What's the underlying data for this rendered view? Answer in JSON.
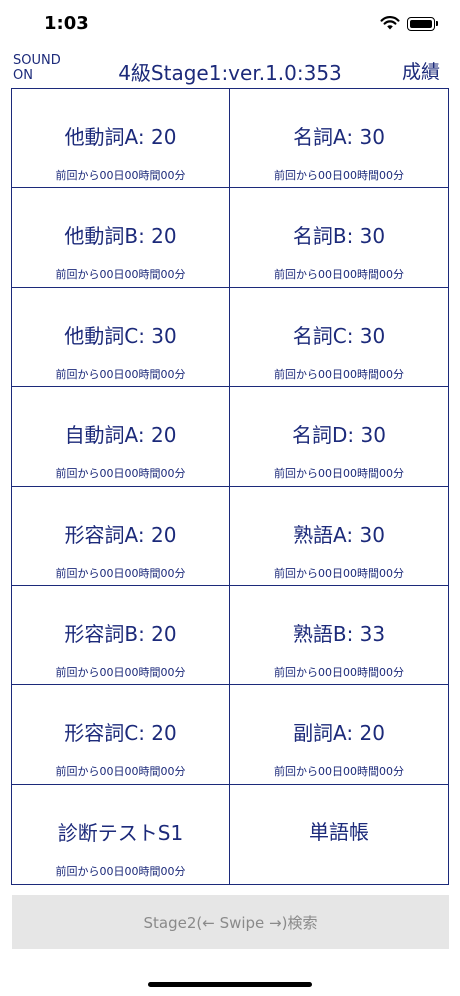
{
  "status": {
    "time": "1:03"
  },
  "header": {
    "sound_label": "SOUND",
    "sound_state": "ON",
    "title": "4級Stage1:ver.1.0:353",
    "score_label": "成績"
  },
  "grid": {
    "items": [
      {
        "label": "他動詞A: 20",
        "sub": "前回から00日00時間00分"
      },
      {
        "label": "名詞A: 30",
        "sub": "前回から00日00時間00分"
      },
      {
        "label": "他動詞B: 20",
        "sub": "前回から00日00時間00分"
      },
      {
        "label": "名詞B: 30",
        "sub": "前回から00日00時間00分"
      },
      {
        "label": "他動詞C: 30",
        "sub": "前回から00日00時間00分"
      },
      {
        "label": "名詞C: 30",
        "sub": "前回から00日00時間00分"
      },
      {
        "label": "自動詞A: 20",
        "sub": "前回から00日00時間00分"
      },
      {
        "label": "名詞D: 30",
        "sub": "前回から00日00時間00分"
      },
      {
        "label": "形容詞A: 20",
        "sub": "前回から00日00時間00分"
      },
      {
        "label": "熟語A: 30",
        "sub": "前回から00日00時間00分"
      },
      {
        "label": "形容詞B: 20",
        "sub": "前回から00日00時間00分"
      },
      {
        "label": "熟語B: 33",
        "sub": "前回から00日00時間00分"
      },
      {
        "label": "形容詞C: 20",
        "sub": "前回から00日00時間00分"
      },
      {
        "label": "副詞A: 20",
        "sub": "前回から00日00時間00分"
      },
      {
        "label": "診断テストS1",
        "sub": "前回から00日00時間00分"
      },
      {
        "label": "単語帳"
      }
    ]
  },
  "footer": {
    "button_label": "Stage2(← Swipe →)検索"
  },
  "colors": {
    "accent": "#1c2a7a",
    "button_bg": "#e6e6e6",
    "button_text": "#8a8a8a"
  },
  "icons": {
    "wifi": "wifi-icon",
    "battery": "battery-icon"
  }
}
